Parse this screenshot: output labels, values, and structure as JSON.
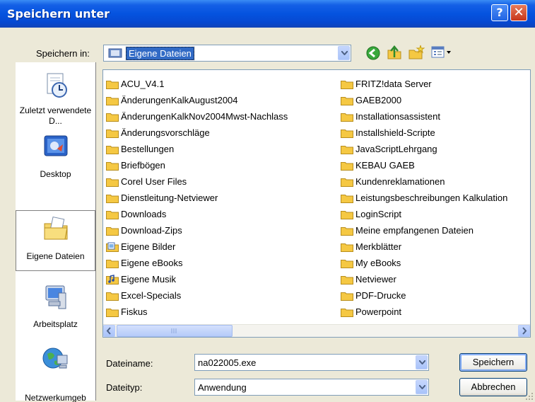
{
  "window": {
    "title": "Speichern unter"
  },
  "titlebar": {
    "help_label": "?",
    "close_label": "✕"
  },
  "savein": {
    "label": "Speichern in:",
    "value": "Eigene Dateien"
  },
  "places": [
    {
      "label": "Zuletzt verwendete D...",
      "icon": "recent-documents-icon"
    },
    {
      "label": "Desktop",
      "icon": "desktop-icon"
    },
    {
      "label": "Eigene Dateien",
      "icon": "my-documents-icon"
    },
    {
      "label": "Arbeitsplatz",
      "icon": "my-computer-icon"
    },
    {
      "label": "Netzwerkumgeb",
      "icon": "network-icon"
    }
  ],
  "files": {
    "left": [
      "ACU_V4.1",
      "ÄnderungenKalkAugust2004",
      "ÄnderungenKalkNov2004Mwst-Nachlass",
      "Änderungsvorschläge",
      "Bestellungen",
      "Briefbögen",
      "Corel User Files",
      "Dienstleitung-Netviewer",
      "Downloads",
      "Download-Zips",
      "Eigene Bilder",
      "Eigene eBooks",
      "Eigene Musik",
      "Excel-Specials",
      "Fiskus"
    ],
    "right": [
      "FRITZ!data Server",
      "GAEB2000",
      "Installationsassistent",
      "Installshield-Scripte",
      "JavaScriptLehrgang",
      "KEBAU GAEB",
      "Kundenreklamationen",
      "Leistungsbeschreibungen Kalkulation",
      "LoginScript",
      "Meine empfangenen Dateien",
      "Merkblätter",
      "My eBooks",
      "Netviewer",
      "PDF-Drucke",
      "Powerpoint"
    ]
  },
  "filename": {
    "label": "Dateiname:",
    "value": "na022005.exe"
  },
  "filetype": {
    "label": "Dateityp:",
    "value": "Anwendung"
  },
  "buttons": {
    "save": "Speichern",
    "cancel": "Abbrechen"
  },
  "colors": {
    "titlebar": "#0553DF",
    "dialog_bg": "#ECE9D8",
    "folder": "#F5C843",
    "selection": "#316AC5"
  }
}
